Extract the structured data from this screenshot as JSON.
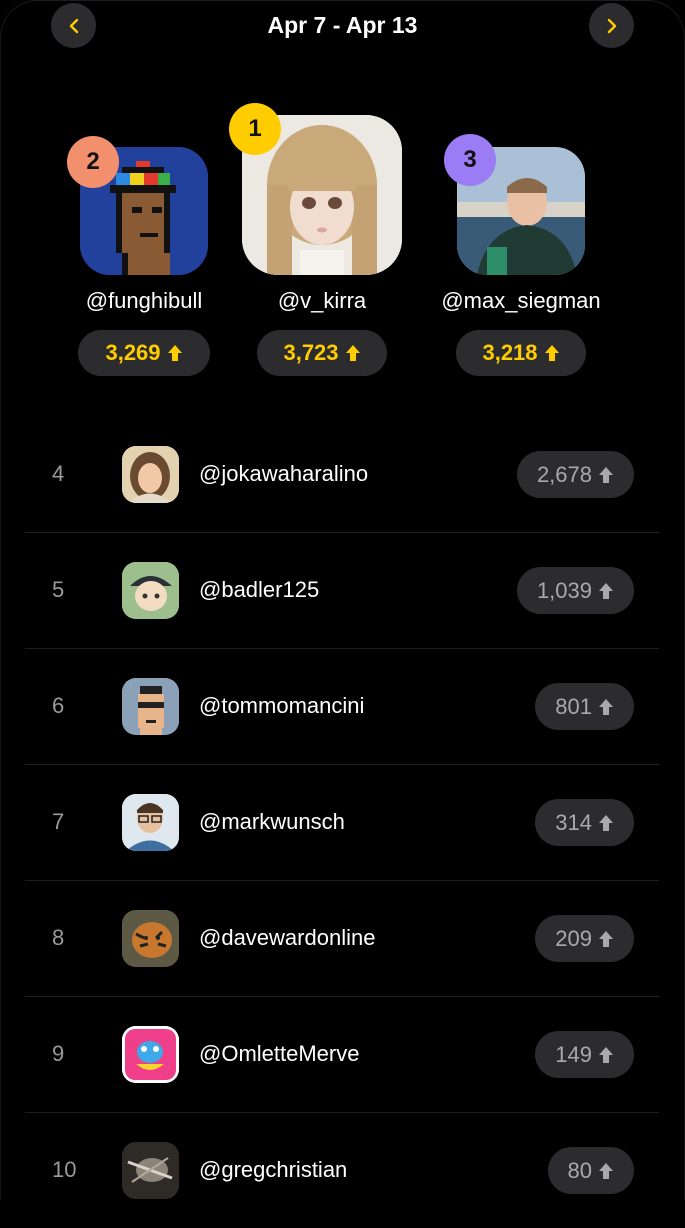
{
  "header": {
    "title": "Apr 7 - Apr 13"
  },
  "colors": {
    "gold": "#ffcc00",
    "silver_badge": "#f2906e",
    "bronze_badge": "#9b7cf5",
    "pill_bg": "#2c2c2e"
  },
  "podium": [
    {
      "rank": "2",
      "handle": "@funghibull",
      "score": "3,269",
      "icon": "pixel-punk-avatar"
    },
    {
      "rank": "1",
      "handle": "@v_kirra",
      "score": "3,723",
      "icon": "doll-avatar"
    },
    {
      "rank": "3",
      "handle": "@max_siegman",
      "score": "3,218",
      "icon": "photo-avatar"
    }
  ],
  "list": [
    {
      "rank": "4",
      "handle": "@jokawaharalino",
      "score": "2,678"
    },
    {
      "rank": "5",
      "handle": "@badler125",
      "score": "1,039"
    },
    {
      "rank": "6",
      "handle": "@tommomancini",
      "score": "801"
    },
    {
      "rank": "7",
      "handle": "@markwunsch",
      "score": "314"
    },
    {
      "rank": "8",
      "handle": "@davewardonline",
      "score": "209"
    },
    {
      "rank": "9",
      "handle": "@OmletteMerve",
      "score": "149"
    },
    {
      "rank": "10",
      "handle": "@gregchristian",
      "score": "80"
    }
  ]
}
